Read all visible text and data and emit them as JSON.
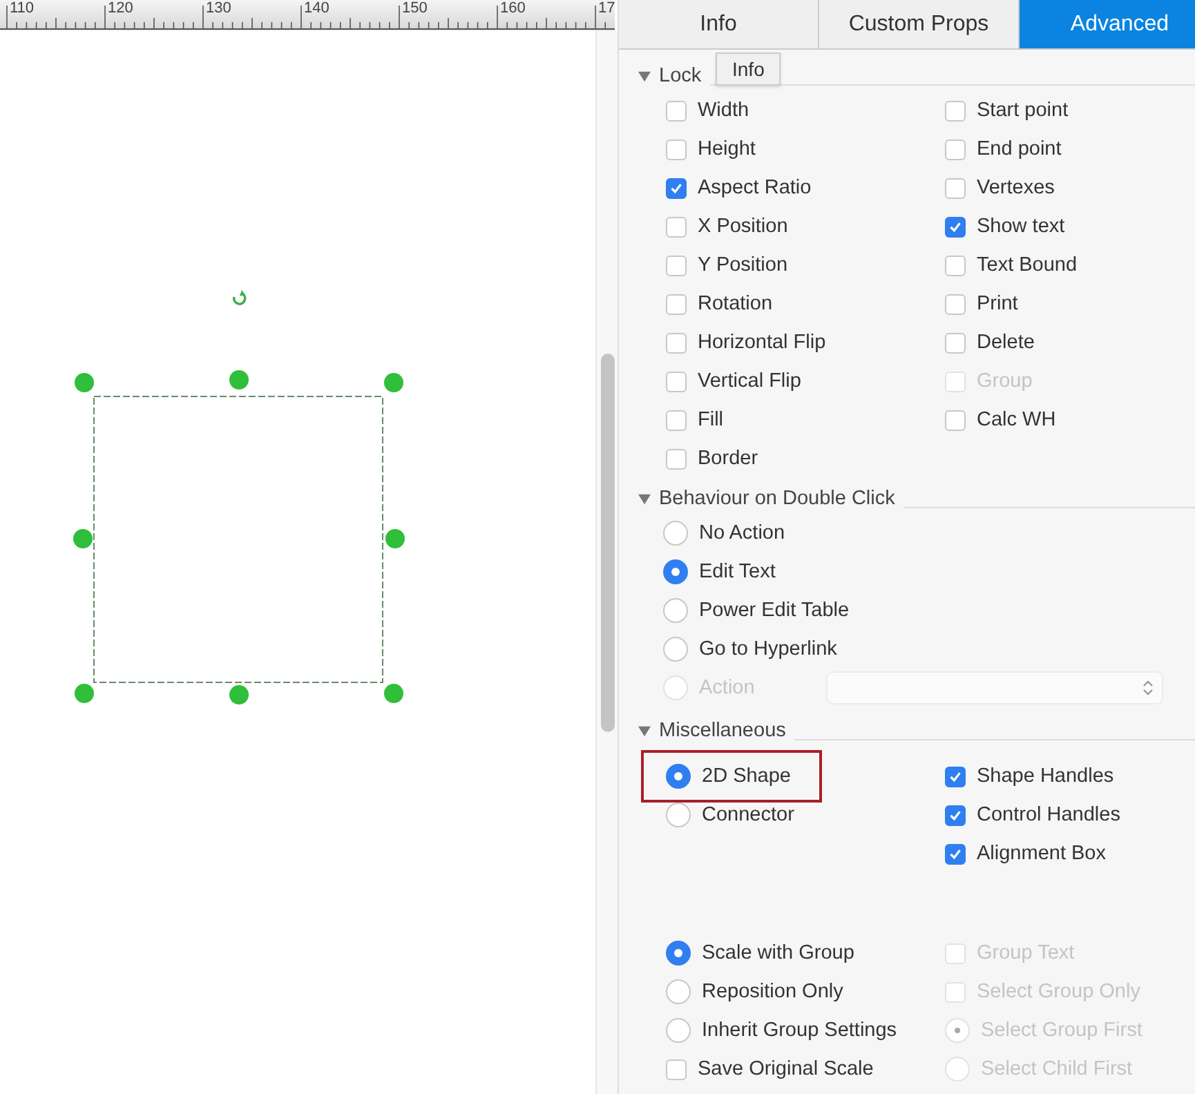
{
  "ruler": {
    "labels": [
      "110",
      "120",
      "130",
      "140",
      "150",
      "160",
      "17"
    ]
  },
  "tabs": [
    {
      "label": "Info",
      "selected": false
    },
    {
      "label": "Custom Props",
      "selected": false
    },
    {
      "label": "Advanced",
      "selected": true
    }
  ],
  "tooltip": {
    "text": "Info"
  },
  "lock": {
    "title": "Lock",
    "expanded": true,
    "left": [
      {
        "label": "Width",
        "checked": false,
        "disabled": false
      },
      {
        "label": "Height",
        "checked": false,
        "disabled": false
      },
      {
        "label": "Aspect Ratio",
        "checked": true,
        "disabled": false
      },
      {
        "label": "X Position",
        "checked": false,
        "disabled": false
      },
      {
        "label": "Y Position",
        "checked": false,
        "disabled": false
      },
      {
        "label": "Rotation",
        "checked": false,
        "disabled": false
      },
      {
        "label": "Horizontal Flip",
        "checked": false,
        "disabled": false
      },
      {
        "label": "Vertical Flip",
        "checked": false,
        "disabled": false
      },
      {
        "label": "Fill",
        "checked": false,
        "disabled": false
      },
      {
        "label": "Border",
        "checked": false,
        "disabled": false
      }
    ],
    "right": [
      {
        "label": "Start point",
        "checked": false,
        "disabled": false
      },
      {
        "label": "End point",
        "checked": false,
        "disabled": false
      },
      {
        "label": "Vertexes",
        "checked": false,
        "disabled": false
      },
      {
        "label": "Show text",
        "checked": true,
        "disabled": false
      },
      {
        "label": "Text Bound",
        "checked": false,
        "disabled": false
      },
      {
        "label": "Print",
        "checked": false,
        "disabled": false
      },
      {
        "label": "Delete",
        "checked": false,
        "disabled": false
      },
      {
        "label": "Group",
        "checked": false,
        "disabled": true
      },
      {
        "label": "Calc WH",
        "checked": false,
        "disabled": false
      }
    ]
  },
  "behaviour": {
    "title": "Behaviour on Double Click",
    "expanded": true,
    "options": [
      {
        "label": "No Action",
        "selected": false,
        "disabled": false
      },
      {
        "label": "Edit Text",
        "selected": true,
        "disabled": false
      },
      {
        "label": "Power Edit Table",
        "selected": false,
        "disabled": false
      },
      {
        "label": "Go to Hyperlink",
        "selected": false,
        "disabled": false
      },
      {
        "label": "Action",
        "selected": false,
        "disabled": true
      }
    ],
    "action_dropdown": {
      "disabled": true
    }
  },
  "miscellaneous": {
    "title": "Miscellaneous",
    "expanded": true,
    "shape_type": [
      {
        "label": "2D Shape",
        "selected": true,
        "highlighted": true
      },
      {
        "label": "Connector",
        "selected": false,
        "highlighted": false
      }
    ],
    "handles": [
      {
        "label": "Shape Handles",
        "checked": true
      },
      {
        "label": "Control Handles",
        "checked": true
      },
      {
        "label": "Alignment Box",
        "checked": true
      }
    ],
    "group_scaling": [
      {
        "kind": "radio",
        "label": "Scale with Group",
        "selected": true,
        "disabled": false
      },
      {
        "kind": "radio",
        "label": "Reposition Only",
        "selected": false,
        "disabled": false
      },
      {
        "kind": "radio",
        "label": "Inherit Group Settings",
        "selected": false,
        "disabled": false
      },
      {
        "kind": "checkbox",
        "label": "Save Original Scale",
        "checked": false,
        "disabled": false
      }
    ],
    "group_options": [
      {
        "kind": "checkbox",
        "label": "Group Text",
        "checked": false,
        "disabled": true
      },
      {
        "kind": "checkbox",
        "label": "Select Group Only",
        "checked": false,
        "disabled": true
      },
      {
        "kind": "radio",
        "label": "Select Group First",
        "selected": true,
        "disabled": true
      },
      {
        "kind": "radio",
        "label": "Select Child First",
        "selected": false,
        "disabled": true
      }
    ]
  }
}
